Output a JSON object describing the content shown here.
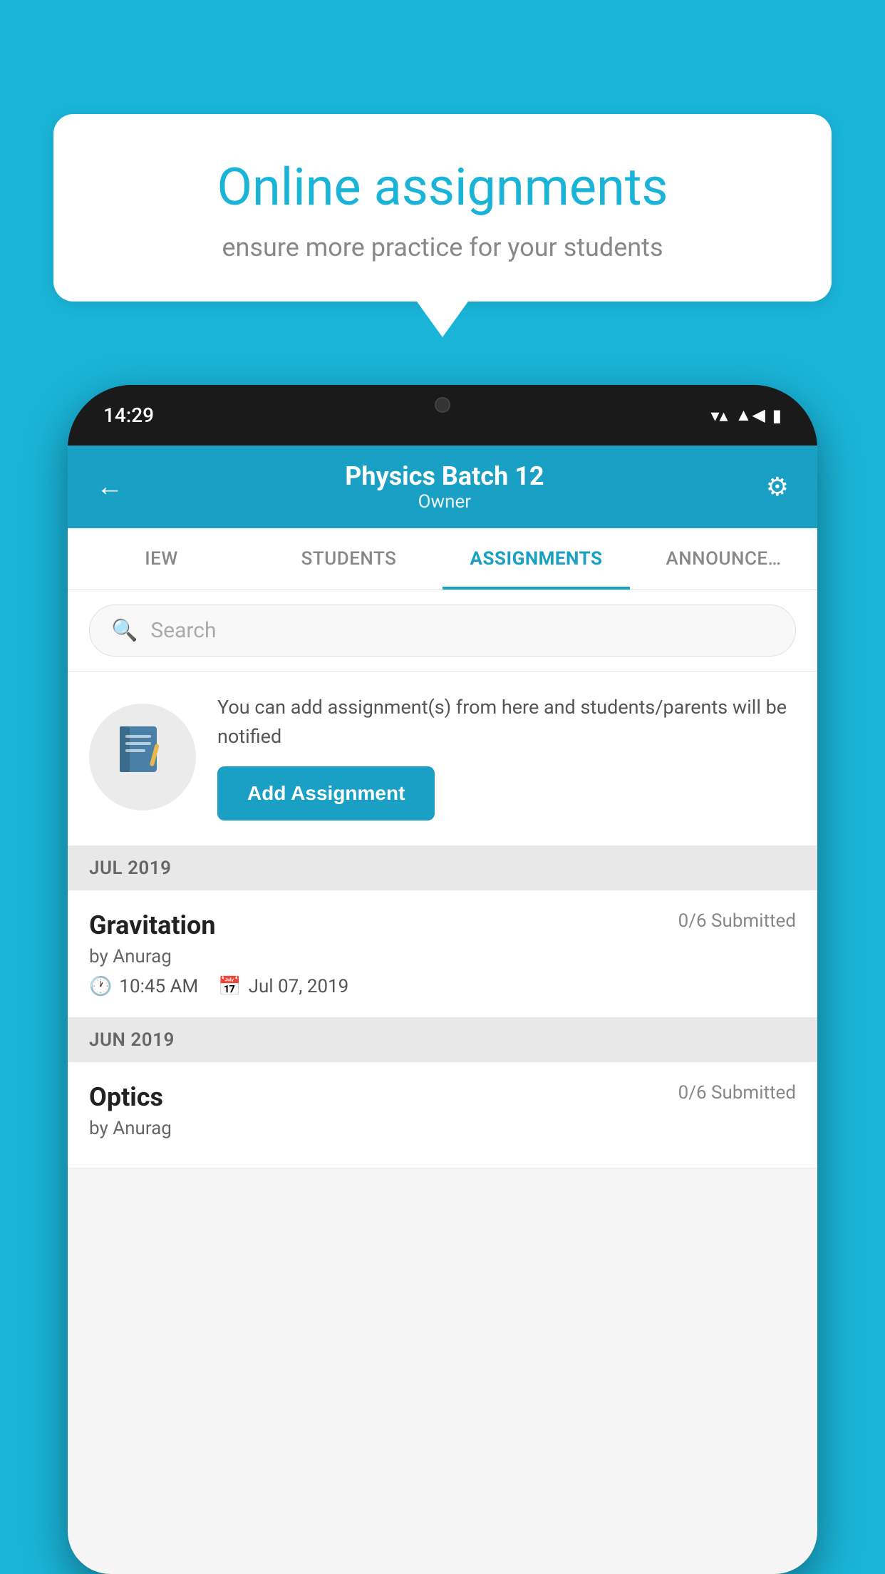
{
  "background": {
    "color": "#1ab4d8"
  },
  "speech_bubble": {
    "title": "Online assignments",
    "subtitle": "ensure more practice for your students"
  },
  "phone": {
    "status_bar": {
      "time": "14:29",
      "wifi": "▼",
      "signal": "▲",
      "battery": "▌"
    },
    "header": {
      "title": "Physics Batch 12",
      "subtitle": "Owner",
      "back_label": "←",
      "settings_label": "⚙"
    },
    "tabs": [
      {
        "label": "IEW",
        "active": false
      },
      {
        "label": "STUDENTS",
        "active": false
      },
      {
        "label": "ASSIGNMENTS",
        "active": true
      },
      {
        "label": "ANNOUNCEMENTS",
        "active": false
      }
    ],
    "search": {
      "placeholder": "Search"
    },
    "promo": {
      "text": "You can add assignment(s) from here and students/parents will be notified",
      "button_label": "Add Assignment"
    },
    "sections": [
      {
        "label": "JUL 2019",
        "assignments": [
          {
            "title": "Gravitation",
            "submitted": "0/6 Submitted",
            "by": "by Anurag",
            "time": "10:45 AM",
            "date": "Jul 07, 2019"
          }
        ]
      },
      {
        "label": "JUN 2019",
        "assignments": [
          {
            "title": "Optics",
            "submitted": "0/6 Submitted",
            "by": "by Anurag",
            "time": "",
            "date": ""
          }
        ]
      }
    ]
  }
}
